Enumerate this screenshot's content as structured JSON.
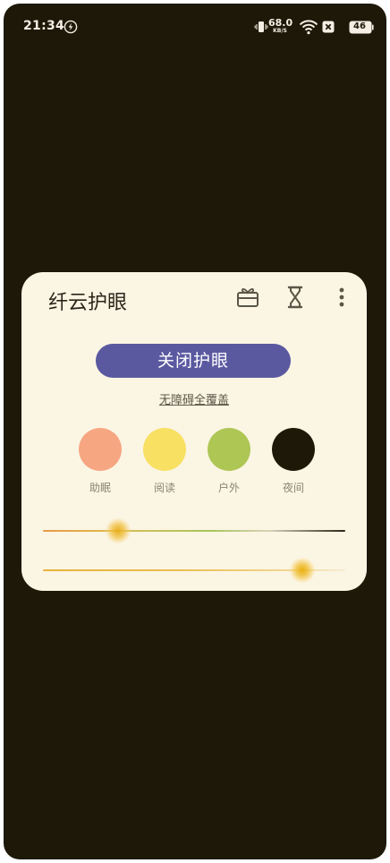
{
  "status_bar": {
    "time": "21:34",
    "net_speed_value": "68.0",
    "net_speed_unit": "KB/S",
    "battery": "46",
    "icons": [
      "charge-icon",
      "vibrate-icon",
      "wifi-icon",
      "no-signal-icon",
      "battery-icon"
    ]
  },
  "card": {
    "title": "纤云护眼",
    "header_icons": [
      "gift-icon",
      "hourglass-icon",
      "more-vert-icon"
    ],
    "toggle_label": "关闭护眼",
    "overlay_link": "无障碍全覆盖",
    "modes": [
      {
        "label": "助眠",
        "color": "#f6a681"
      },
      {
        "label": "阅读",
        "color": "#f8e063"
      },
      {
        "label": "户外",
        "color": "#adc654"
      },
      {
        "label": "夜间",
        "color": "#1d1808"
      }
    ],
    "colors": {
      "background": "#1d1808",
      "card": "#fbf5e4",
      "accent": "#5a59a0"
    },
    "sliders": {
      "color_temperature_fraction": 0.25,
      "brightness_fraction": 0.86
    }
  }
}
